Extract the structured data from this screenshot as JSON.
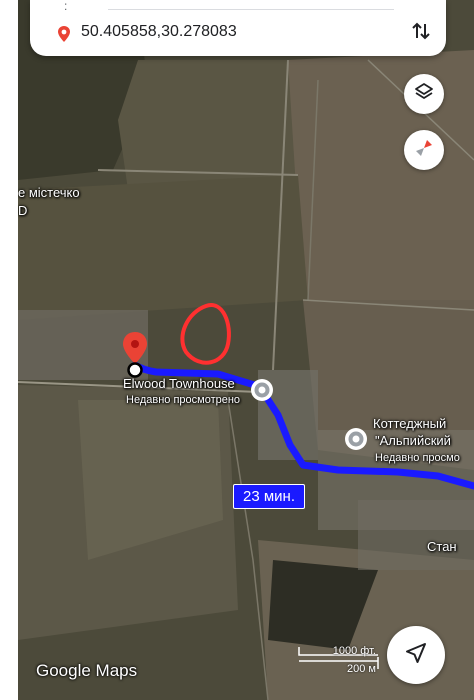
{
  "search": {
    "coordinates": "50.405858,30.278083"
  },
  "labels": {
    "town_partial": "е містечко",
    "town_partial_2": "D",
    "place_1_name": "Elwood Townhouse",
    "place_1_sub": "Недавно просмотрено",
    "place_2_line1": "Коттеджный",
    "place_2_line2": "\"Альпийский",
    "place_2_sub": "Недавно просмо",
    "place_3": "Стан"
  },
  "route": {
    "duration": "23 мин.",
    "color": "#1a1aff"
  },
  "scale": {
    "imperial": "1000 фт.",
    "metric": "200 м"
  },
  "brand": {
    "logo": "Google Maps"
  },
  "controls": {
    "layers_icon": "layers-icon",
    "compass_icon": "compass-icon",
    "navigate_icon": "navigate-arrow-icon",
    "swap_icon": "swap-vertical-icon"
  },
  "colors": {
    "marker_red": "#ea4335",
    "annotation_red": "#ff3030",
    "grey_pin": "#9aa0a6"
  }
}
